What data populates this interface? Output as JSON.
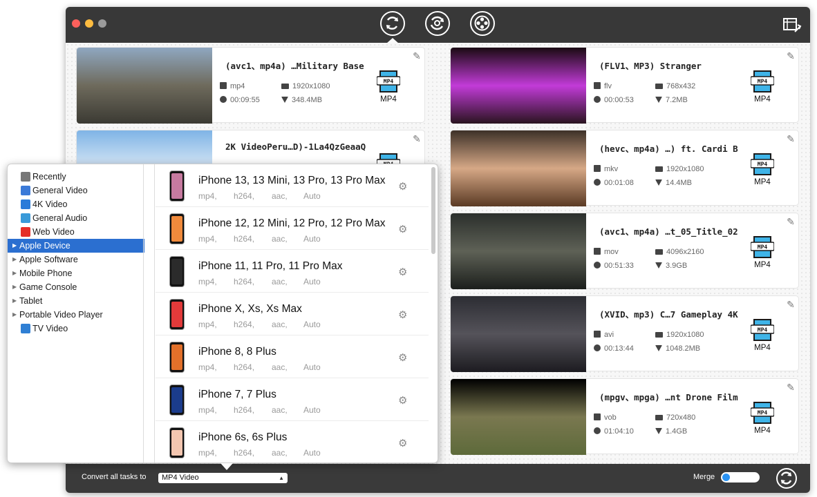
{
  "toolbar": {
    "buttons": [
      {
        "name": "convert-tab",
        "icon": "refresh-icon"
      },
      {
        "name": "rotate-tab",
        "icon": "rotate-icon"
      },
      {
        "name": "film-tab",
        "icon": "film-reel-icon"
      }
    ],
    "right_icon": "convert-list-icon"
  },
  "videos": [
    {
      "title": "(avc1、mp4a) …Military Base",
      "format": "mp4",
      "resolution": "1920x1080",
      "duration": "00:09:55",
      "size": "348.4MB",
      "output": "MP4",
      "thumb": [
        "#8fa7c0",
        "#6e6a5c",
        "#3b3a33"
      ]
    },
    {
      "title": "2K VideoPeru…D)-1La4QzGeaaQ",
      "format": "",
      "resolution": "",
      "duration": "",
      "size": "",
      "output": "MP4",
      "thumb": [
        "#7fb4e6",
        "#d8e7f5",
        "#eaf2fa"
      ]
    },
    {
      "title": "(FLV1、MP3) Stranger",
      "format": "flv",
      "resolution": "768x432",
      "duration": "00:00:53",
      "size": "7.2MB",
      "output": "MP4",
      "thumb": [
        "#1a0a12",
        "#c23bd8",
        "#2a1420"
      ]
    },
    {
      "title": "(hevc、mp4a) …) ft. Cardi B",
      "format": "mkv",
      "resolution": "1920x1080",
      "duration": "00:01:08",
      "size": "14.4MB",
      "output": "MP4",
      "thumb": [
        "#3d3128",
        "#d6a886",
        "#5a3a24"
      ]
    },
    {
      "title": "(avc1、mp4a) …t_05_Title_02",
      "format": "mov",
      "resolution": "4096x2160",
      "duration": "00:51:33",
      "size": "3.9GB",
      "output": "MP4",
      "thumb": [
        "#2b2f2c",
        "#5e6156",
        "#1c1f1c"
      ]
    },
    {
      "title": "(XVID、mp3) C…7 Gameplay 4K",
      "format": "avi",
      "resolution": "1920x1080",
      "duration": "00:13:44",
      "size": "1048.2MB",
      "output": "MP4",
      "thumb": [
        "#2c2d33",
        "#55535a",
        "#1c1b20"
      ]
    },
    {
      "title": "(mpgv、mpga) …nt Drone Film",
      "format": "vob",
      "resolution": "720x480",
      "duration": "01:04:10",
      "size": "1.4GB",
      "output": "MP4",
      "thumb": [
        "#000000",
        "#7a7850",
        "#5d6a3a"
      ]
    }
  ],
  "categories": [
    {
      "label": "Recently",
      "icon": "clock-icon",
      "color": "#777777",
      "expandable": false
    },
    {
      "label": "General Video",
      "icon": "film-icon",
      "color": "#3b7ad8",
      "expandable": false
    },
    {
      "label": "4K Video",
      "icon": "4k-icon",
      "color": "#2a7bd9",
      "expandable": false
    },
    {
      "label": "General Audio",
      "icon": "music-note-icon",
      "color": "#3a9ad9",
      "expandable": false
    },
    {
      "label": "Web Video",
      "icon": "youtube-icon",
      "color": "#e52d27",
      "expandable": false
    },
    {
      "label": "Apple Device",
      "icon": "",
      "color": "",
      "expandable": true,
      "selected": true
    },
    {
      "label": "Apple Software",
      "icon": "",
      "color": "",
      "expandable": true
    },
    {
      "label": "Mobile Phone",
      "icon": "",
      "color": "",
      "expandable": true
    },
    {
      "label": "Game Console",
      "icon": "",
      "color": "",
      "expandable": true
    },
    {
      "label": "Tablet",
      "icon": "",
      "color": "",
      "expandable": true
    },
    {
      "label": "Portable Video Player",
      "icon": "",
      "color": "",
      "expandable": true
    },
    {
      "label": "TV Video",
      "icon": "tv-icon",
      "color": "#2f7fd4",
      "expandable": false
    }
  ],
  "devices": [
    {
      "name": "iPhone 13, 13 Mini, 13 Pro, 13 Pro Max",
      "specs": [
        "mp4,",
        "h264,",
        "aac,",
        "Auto"
      ],
      "screen": "#c77aa0"
    },
    {
      "name": "iPhone 12, 12 Mini, 12 Pro, 12 Pro Max",
      "specs": [
        "mp4,",
        "h264,",
        "aac,",
        "Auto"
      ],
      "screen": "#f08a3c"
    },
    {
      "name": "iPhone 11, 11 Pro, 11 Pro Max",
      "specs": [
        "mp4,",
        "h264,",
        "aac,",
        "Auto"
      ],
      "screen": "#2b2b2b"
    },
    {
      "name": "iPhone X, Xs, Xs Max",
      "specs": [
        "mp4,",
        "h264,",
        "aac,",
        "Auto"
      ],
      "screen": "#e23a3a"
    },
    {
      "name": "iPhone 8, 8 Plus",
      "specs": [
        "mp4,",
        "h264,",
        "aac,",
        "Auto"
      ],
      "screen": "#e2702a"
    },
    {
      "name": "iPhone 7, 7 Plus",
      "specs": [
        "mp4,",
        "h264,",
        "aac,",
        "Auto"
      ],
      "screen": "#1b3c8c"
    },
    {
      "name": "iPhone 6s, 6s Plus",
      "specs": [
        "mp4,",
        "h264,",
        "aac,",
        "Auto"
      ],
      "screen": "#f3c6b0"
    }
  ],
  "bottom": {
    "convert_label": "Convert all tasks to",
    "format_value": "MP4 Video",
    "merge_label": "Merge",
    "merge_on": true
  },
  "colors": {
    "accent": "#2b6fd0",
    "toolbar": "#383838",
    "toggle": "#2a93f4"
  }
}
